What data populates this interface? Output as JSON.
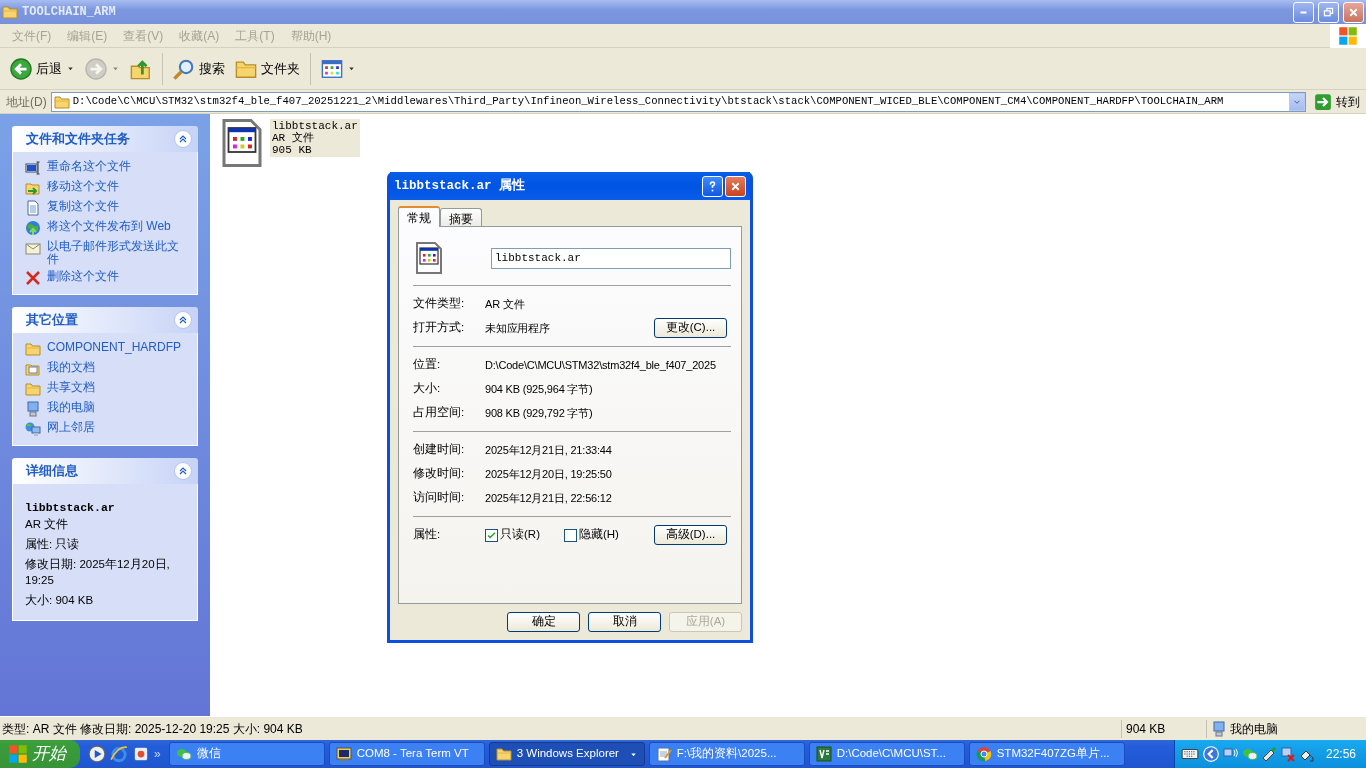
{
  "window": {
    "title": "TOOLCHAIN_ARM"
  },
  "menu": [
    {
      "label": "文件(F)"
    },
    {
      "label": "编辑(E)"
    },
    {
      "label": "查看(V)"
    },
    {
      "label": "收藏(A)"
    },
    {
      "label": "工具(T)"
    },
    {
      "label": "帮助(H)"
    }
  ],
  "toolbar": [
    {
      "kind": "back",
      "label": "后退",
      "disabled": false
    },
    {
      "kind": "forward",
      "disabled": true
    },
    {
      "kind": "up",
      "disabled": false
    },
    {
      "kind": "search",
      "label": "搜索",
      "disabled": false
    },
    {
      "kind": "folders",
      "label": "文件夹",
      "disabled": false
    },
    {
      "kind": "views",
      "disabled": false
    }
  ],
  "address": {
    "label": "地址(D)",
    "value": "D:\\Code\\C\\MCU\\STM32\\stm32f4_ble_f407_20251221_2\\Middlewares\\Third_Party\\Infineon_Wireless_Connectivity\\btstack\\stack\\COMPONENT_WICED_BLE\\COMPONENT_CM4\\COMPONENT_HARDFP\\TOOLCHAIN_ARM",
    "go": "转到"
  },
  "task_panels": [
    {
      "title": "文件和文件夹任务",
      "expanded": true,
      "items": [
        {
          "label": "重命名这个文件"
        },
        {
          "label": "移动这个文件"
        },
        {
          "label": "复制这个文件"
        },
        {
          "label": "将这个文件发布到 Web"
        },
        {
          "label": "以电子邮件形式发送此文件"
        },
        {
          "label": "删除这个文件"
        }
      ]
    },
    {
      "title": "其它位置",
      "expanded": true,
      "items": [
        {
          "label": "COMPONENT_HARDFP"
        },
        {
          "label": "我的文档"
        },
        {
          "label": "共享文档"
        },
        {
          "label": "我的电脑"
        },
        {
          "label": "网上邻居"
        }
      ]
    }
  ],
  "details": {
    "title": "详细信息",
    "expanded": true,
    "name": "libbtstack.ar",
    "type": "AR 文件",
    "lines": [
      "属性: 只读",
      "修改日期: 2025年12月20日, 19:25",
      "大小: 904 KB"
    ]
  },
  "files": [
    {
      "name": "libbtstack.ar",
      "type": "AR 文件",
      "size": "905 KB",
      "selected": true
    }
  ],
  "dialog": {
    "title": "libbtstack.ar 属性",
    "tabs": [
      {
        "label": "常规",
        "selected": true
      },
      {
        "label": "摘要",
        "selected": false
      }
    ],
    "filename": "libbtstack.ar",
    "sections": [
      [
        {
          "label": "文件类型:",
          "value": "AR 文件"
        },
        {
          "label": "打开方式:",
          "value": "未知应用程序",
          "button": "更改(C)..."
        }
      ],
      [
        {
          "label": "位置:",
          "value": "D:\\Code\\C\\MCU\\STM32\\stm32f4_ble_f407_2025"
        },
        {
          "label": "大小:",
          "value": "904 KB (925,964 字节)"
        },
        {
          "label": "占用空间:",
          "value": "908 KB (929,792 字节)"
        }
      ],
      [
        {
          "label": "创建时间:",
          "value": "2025年12月21日, 21:33:44"
        },
        {
          "label": "修改时间:",
          "value": "2025年12月20日, 19:25:50"
        },
        {
          "label": "访问时间:",
          "value": "2025年12月21日, 22:56:12"
        }
      ]
    ],
    "attributes": {
      "label": "属性:",
      "checkboxes": [
        {
          "label": "只读(R)",
          "checked": true
        },
        {
          "label": "隐藏(H)",
          "checked": false
        }
      ],
      "button": "高级(D)..."
    },
    "buttons": [
      {
        "label": "确定",
        "disabled": false
      },
      {
        "label": "取消",
        "disabled": false
      },
      {
        "label": "应用(A)",
        "disabled": true
      }
    ]
  },
  "status_bar": {
    "text": "类型: AR 文件 修改日期: 2025-12-20 19:25 大小: 904 KB",
    "size": "904 KB",
    "zone": "我的电脑"
  },
  "taskbar": {
    "start": "开始",
    "more": "»",
    "tasks": [
      {
        "kind": "wechat",
        "label": "微信",
        "selected": false
      },
      {
        "kind": "terminal",
        "label": "COM8 - Tera Term VT",
        "selected": false
      },
      {
        "kind": "folder",
        "label": "3 Windows Explorer",
        "selected": true
      },
      {
        "kind": "notepad",
        "label": "F:\\我的资料\\2025...",
        "selected": false
      },
      {
        "kind": "editor",
        "label": "D:\\Code\\C\\MCU\\ST...",
        "selected": false
      },
      {
        "kind": "browser",
        "label": "STM32F407ZG单片...",
        "selected": false
      }
    ],
    "clock": "22:56"
  }
}
